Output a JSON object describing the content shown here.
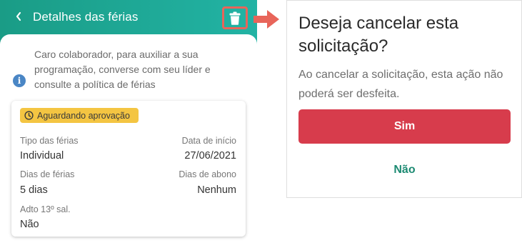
{
  "header": {
    "title": "Detalhes das férias",
    "back_icon": "chevron-left-icon",
    "delete_icon": "trash-icon"
  },
  "info": {
    "icon": "info-icon",
    "text": "Caro colaborador, para auxiliar a sua programação, converse com seu líder e consulte a política de férias"
  },
  "card": {
    "status": "Aguardando aprovação",
    "status_icon": "clock-icon",
    "fields": {
      "tipo_label": "Tipo das férias",
      "tipo_value": "Individual",
      "inicio_label": "Data de início",
      "inicio_value": "27/06/2021",
      "dias_label": "Dias de férias",
      "dias_value": "5 dias",
      "abono_label": "Dias de abono",
      "abono_value": "Nenhum",
      "adto_label": "Adto 13º sal.",
      "adto_value": "Não"
    }
  },
  "dialog": {
    "title": "Deseja cancelar esta solicitação?",
    "message": "Ao cancelar a solicitação, esta ação não poderá ser desfeita.",
    "yes_label": "Sim",
    "no_label": "Não"
  },
  "colors": {
    "header_gradient_start": "#1a9c86",
    "header_gradient_end": "#22b3a4",
    "highlight": "#e8655a",
    "badge": "#f4c542",
    "danger": "#d73c4c",
    "positive": "#1c8a72",
    "info": "#4a86c5"
  }
}
